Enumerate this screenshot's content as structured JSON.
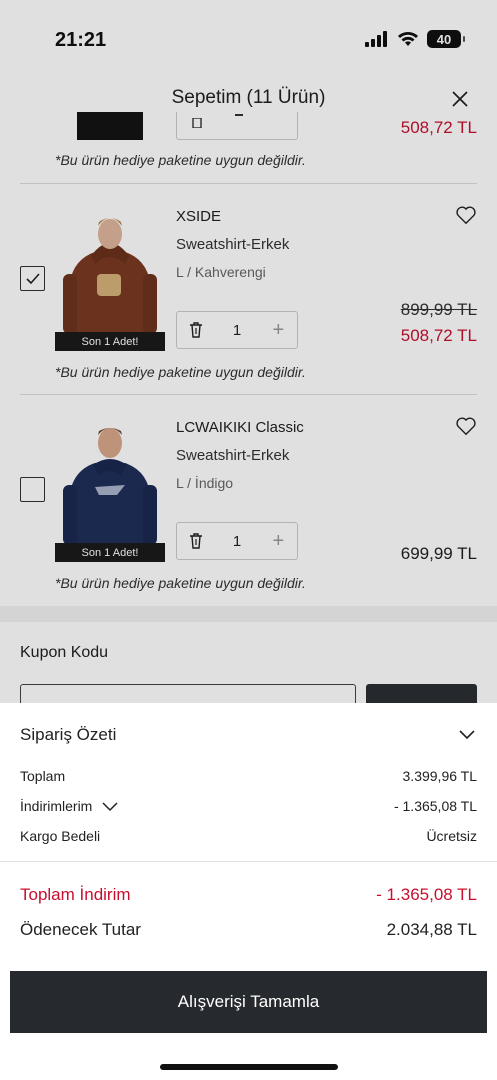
{
  "status_bar": {
    "time": "21:21",
    "battery": "40"
  },
  "header": {
    "title": "Sepetim (11 Ürün)"
  },
  "partial_item": {
    "new_price": "508,72 TL",
    "note": "*Bu ürün hediye paketine uygun değildir."
  },
  "items": [
    {
      "checked": true,
      "badge": "Son 1 Adet!",
      "brand": "XSIDE",
      "type": "Sweatshirt-Erkek",
      "variant": "L / Kahverengi",
      "quantity": "1",
      "old_price": "899,99 TL",
      "new_price": "508,72 TL",
      "note": "*Bu ürün hediye paketine uygun değildir."
    },
    {
      "checked": false,
      "badge": "Son 1 Adet!",
      "brand": "LCWAIKIKI Classic",
      "type": "Sweatshirt-Erkek",
      "variant": "L / İndigo",
      "quantity": "1",
      "price": "699,99 TL",
      "note": "*Bu ürün hediye paketine uygun değildir."
    }
  ],
  "coupon": {
    "label": "Kupon Kodu"
  },
  "summary": {
    "title": "Sipariş Özeti",
    "rows": [
      {
        "label": "Toplam",
        "value": "3.399,96 TL"
      },
      {
        "label": "İndirimlerim",
        "value": "- 1.365,08 TL"
      },
      {
        "label": "Kargo Bedeli",
        "value": "Ücretsiz"
      }
    ],
    "total_discount_label": "Toplam İndirim",
    "total_discount_value": "- 1.365,08 TL",
    "payable_label": "Ödenecek Tutar",
    "payable_value": "2.034,88 TL"
  },
  "cta": {
    "label": "Alışverişi Tamamla"
  },
  "colors": {
    "accent_red": "#c8102e",
    "dark_button": "#26292d"
  }
}
